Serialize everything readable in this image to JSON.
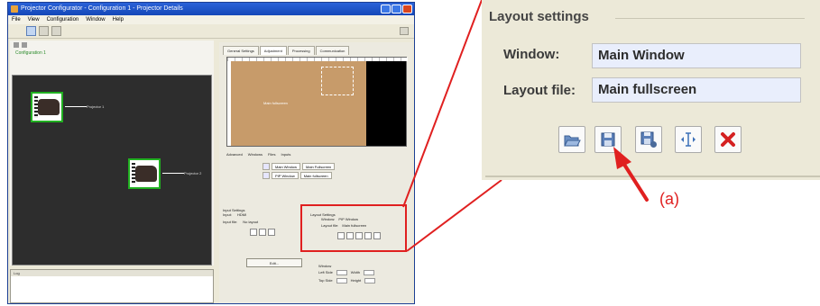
{
  "app": {
    "title": "Projector Configurator - Configuration 1 - Projector Details",
    "menu": [
      "File",
      "View",
      "Configuration",
      "Window",
      "Help"
    ],
    "config_label": "Configuration 1",
    "log_header": "Log",
    "projectors": [
      {
        "tag": "Projector 1"
      },
      {
        "tag": "Projector 2"
      }
    ],
    "tabs": [
      "General Settings",
      "Adjustment",
      "Processing",
      "Communication"
    ],
    "preview_text": "Main fullscreen",
    "display_subtabs": [
      "Advanced",
      "Windows",
      "Files",
      "Inputs"
    ],
    "display_rows": [
      {
        "name": "Main Window",
        "value": "Main Fullscreen"
      },
      {
        "name": "PIP Window",
        "value": "Main fullscreen"
      }
    ],
    "input_settings": {
      "header": "Input Settings",
      "rows": [
        [
          "Input:",
          "HDMI"
        ],
        [
          "Input file:",
          "No layout"
        ]
      ]
    },
    "mini_layout": {
      "header": "Layout Settings",
      "rows": [
        [
          "Window:",
          "PIP Window"
        ],
        [
          "Layout file:",
          "Main fullscreen"
        ]
      ]
    },
    "edit_label": "Edit...",
    "lower_fields": {
      "header": "Window",
      "rows": [
        [
          "Left Side",
          "Width"
        ],
        [
          "Top Side",
          "Height"
        ]
      ]
    }
  },
  "zoom": {
    "title": "Layout settings",
    "window_label": "Window:",
    "window_value": "Main Window",
    "layout_label": "Layout file:",
    "layout_value": "Main fullscreen",
    "buttons": [
      {
        "icon": "open-folder-icon"
      },
      {
        "icon": "save-icon"
      },
      {
        "icon": "save-as-icon"
      },
      {
        "icon": "text-edit-icon"
      },
      {
        "icon": "delete-icon"
      }
    ]
  },
  "callout": {
    "label": "(a)",
    "color": "#e02020"
  }
}
